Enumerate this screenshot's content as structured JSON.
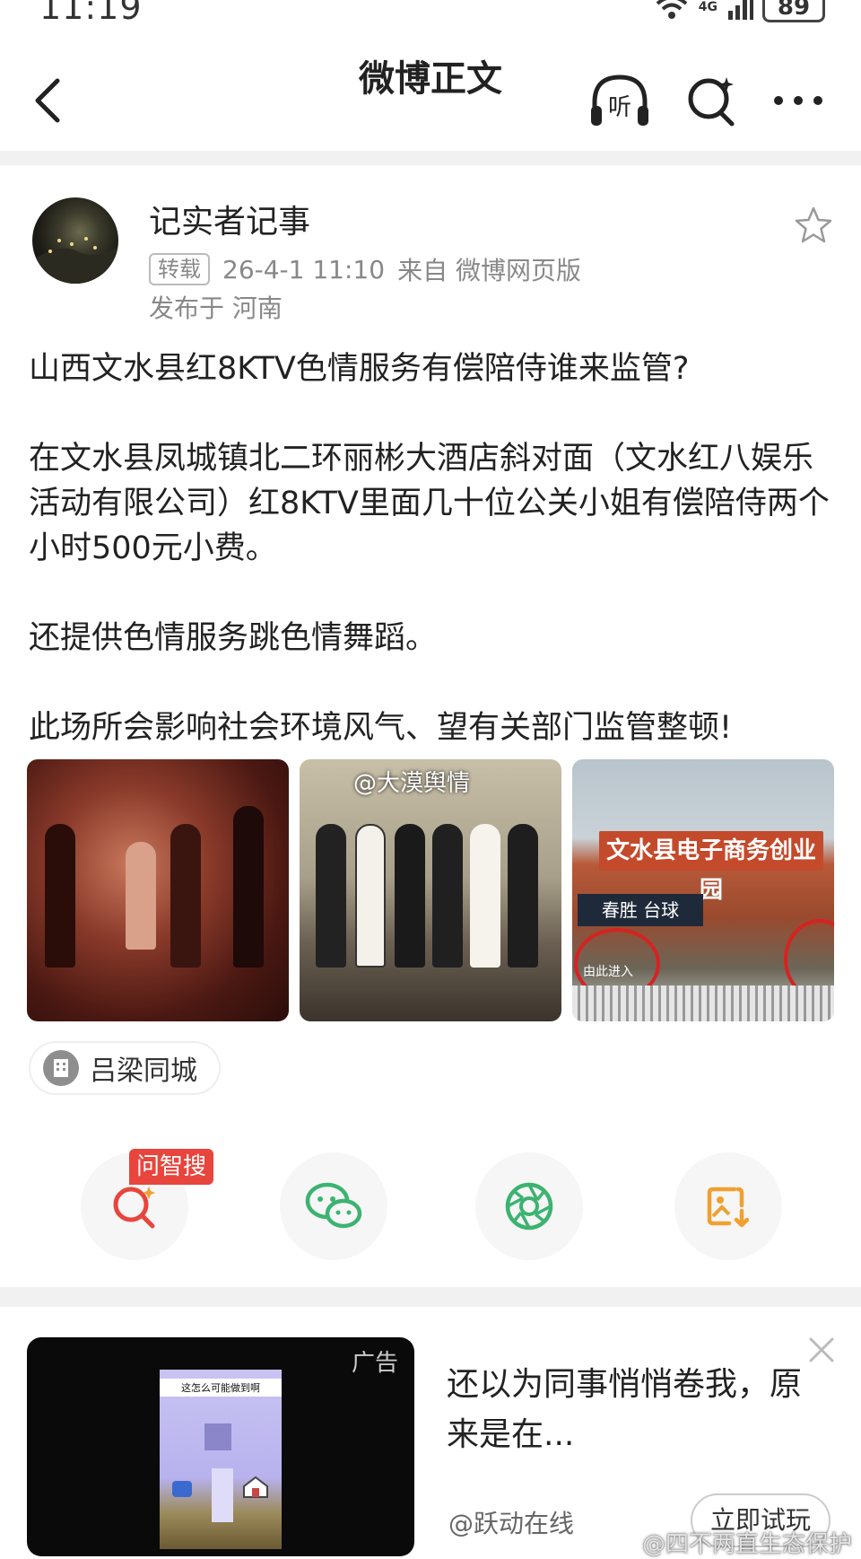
{
  "status_bar": {
    "time": "11:19",
    "network": "4G",
    "battery": "89"
  },
  "nav": {
    "title": "微博正文",
    "listen_label": "听"
  },
  "post": {
    "author": "记实者记事",
    "repost_tag": "转载",
    "timestamp": "26-4-1 11:10",
    "source": "来自 微博网页版",
    "location": "发布于 河南",
    "paragraphs": [
      "山西文水县红8KTV色情服务有偿陪侍谁来监管?",
      "在文水县凤城镇北二环丽彬大酒店斜对面（文水红八娱乐活动有限公司）红8KTV里面几十位公关小姐有偿陪侍两个小时500元小费。",
      "还提供色情服务跳色情舞蹈。",
      "此场所会影响社会环境风气、望有关部门监管整顿!"
    ],
    "images": {
      "img2_watermark": "@大漠舆情",
      "img3_banner": "文水县电子商务创业园",
      "img3_text_sign": "春胜 台球",
      "img3_circle_text": "由此进入"
    },
    "location_chip": "吕梁同城"
  },
  "share": {
    "zhisou_badge": "问智搜",
    "icons": [
      "zhisou-search-icon",
      "wechat-icon",
      "moments-icon",
      "save-image-icon"
    ]
  },
  "ad": {
    "label": "广告",
    "thumb_caption": "这怎么可能做到啊",
    "title": "还以为同事悄悄卷我，原来是在...",
    "source": "@跃动在线",
    "cta": "立即试玩"
  },
  "watermark": "@四不两直生态保护",
  "colors": {
    "accent_red": "#e8453c",
    "wechat_green": "#3cb371",
    "save_orange": "#f0a030",
    "meta_gray": "#888888"
  }
}
